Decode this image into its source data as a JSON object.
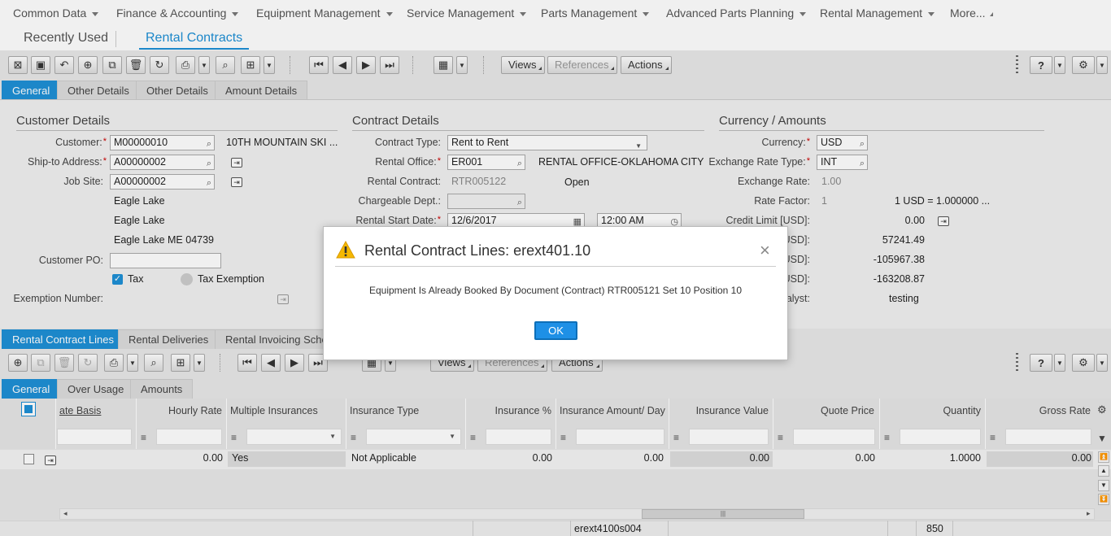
{
  "top_menu": [
    "Common Data",
    "Finance & Accounting",
    "Equipment Management",
    "Service Management",
    "Parts Management",
    "Advanced Parts Planning",
    "Rental Management",
    "More..."
  ],
  "page_tabs": {
    "recent": "Recently Used",
    "active": "Rental Contracts"
  },
  "toolbar": {
    "views": "Views",
    "references": "References",
    "actions": "Actions",
    "help": "?"
  },
  "main_tabs": [
    "General",
    "Other Details",
    "Other Details",
    "Amount Details"
  ],
  "customer": {
    "section": "Customer Details",
    "customer_label": "Customer:",
    "customer_value": "M00000010",
    "customer_name": "10TH MOUNTAIN SKI ...",
    "ship_to_label": "Ship-to Address:",
    "ship_to_value": "A00000002",
    "job_site_label": "Job Site:",
    "job_site_value": "A00000002",
    "address_line1": "Eagle Lake",
    "address_line2": "Eagle Lake",
    "address_line3": "Eagle Lake  ME  04739",
    "po_label": "Customer PO:",
    "po_value": "",
    "tax_label": "Tax",
    "tax_exempt_label": "Tax Exemption",
    "exemption_label": "Exemption Number:"
  },
  "contract": {
    "section": "Contract Details",
    "type_label": "Contract Type:",
    "type_value": "Rent to Rent",
    "office_label": "Rental Office:",
    "office_value": "ER001",
    "office_name": "RENTAL OFFICE-OKLAHOMA CITY",
    "contract_label": "Rental Contract:",
    "contract_value": "RTR005122",
    "contract_status": "Open",
    "dept_label": "Chargeable Dept.:",
    "dept_value": "",
    "start_label": "Rental Start Date:",
    "start_date": "12/6/2017",
    "start_time": "12:00 AM"
  },
  "currency": {
    "section": "Currency / Amounts",
    "currency_label": "Currency:",
    "currency_value": "USD",
    "rate_type_label": "Exchange Rate Type:",
    "rate_type_value": "INT",
    "rate_label": "Exchange Rate:",
    "rate_value": "1.00",
    "factor_label": "Rate Factor:",
    "factor_value": "1",
    "factor_expr": "1  USD  =  1.000000  ...",
    "credit_label": "Credit Limit [USD]:",
    "credit_value": "0.00",
    "usd_partial_1": "USD]:",
    "amount_1": "57241.49",
    "usd_partial_2": "USD]:",
    "amount_2": "-105967.38",
    "usd_partial_3": "USD]:",
    "amount_3": "-163208.87",
    "analyst_partial": "alyst:",
    "analyst_value": "testing"
  },
  "lower_tabs": [
    "Rental Contract Lines",
    "Rental Deliveries",
    "Rental Invoicing Sche"
  ],
  "lower_toolbar": {
    "views": "Views",
    "references": "References",
    "actions": "Actions",
    "help": "?"
  },
  "line_tabs": [
    "General",
    "Over Usage",
    "Amounts"
  ],
  "grid": {
    "columns": [
      "ate Basis",
      "Hourly Rate",
      "Multiple Insurances",
      "Insurance Type",
      "Insurance %",
      "Insurance Amount/ Day",
      "Insurance Value",
      "Quote Price",
      "Quantity",
      "Gross Rate"
    ],
    "row": [
      "0.00",
      "Yes",
      "Not Applicable",
      "0.00",
      "0.00",
      "0.00",
      "0.00",
      "1.0000",
      "0.00"
    ]
  },
  "status_bar": {
    "user": "erext4100s004",
    "code": "850"
  },
  "dialog": {
    "title": "Rental Contract Lines: erext401.10",
    "message": "Equipment Is Already Booked By Document (Contract) RTR005121 Set 10 Position 10",
    "ok_label": "OK",
    "close": "×"
  }
}
